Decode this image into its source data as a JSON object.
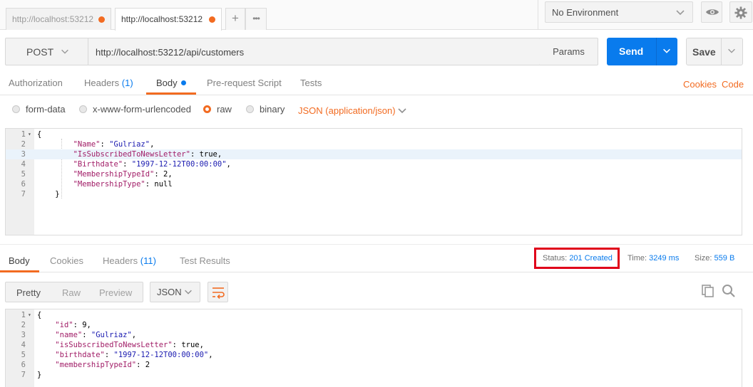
{
  "tabs": [
    {
      "label": "http://localhost:53212",
      "active": false
    },
    {
      "label": "http://localhost:53212",
      "active": true
    }
  ],
  "tab_add_label": "+",
  "tab_more_label": "•••",
  "environment": {
    "selected": "No Environment"
  },
  "request": {
    "method": "POST",
    "url": "http://localhost:53212/api/customers",
    "params_label": "Params",
    "send_label": "Send",
    "save_label": "Save"
  },
  "request_tabs": {
    "authorization": "Authorization",
    "headers": "Headers",
    "headers_count": "(1)",
    "body": "Body",
    "prerequest": "Pre-request Script",
    "tests": "Tests",
    "cookies": "Cookies",
    "code": "Code"
  },
  "body_types": {
    "form_data": "form-data",
    "urlencoded": "x-www-form-urlencoded",
    "raw": "raw",
    "binary": "binary",
    "selected": "raw",
    "content_type": "JSON (application/json)"
  },
  "request_body": {
    "lines": [
      {
        "n": "1",
        "fold": true,
        "tokens": [
          {
            "t": "p",
            "v": "{"
          }
        ]
      },
      {
        "n": "2",
        "tokens": [
          {
            "t": "p",
            "v": "        "
          },
          {
            "t": "k",
            "v": "\"Name\""
          },
          {
            "t": "p",
            "v": ": "
          },
          {
            "t": "s",
            "v": "\"Gulriaz\""
          },
          {
            "t": "p",
            "v": ","
          }
        ]
      },
      {
        "n": "3",
        "hl": true,
        "tokens": [
          {
            "t": "p",
            "v": "        "
          },
          {
            "t": "k",
            "v": "\"IsSubscribedToNewsLetter\""
          },
          {
            "t": "p",
            "v": ": true,"
          }
        ]
      },
      {
        "n": "4",
        "tokens": [
          {
            "t": "p",
            "v": "        "
          },
          {
            "t": "k",
            "v": "\"Birthdate\""
          },
          {
            "t": "p",
            "v": ": "
          },
          {
            "t": "s",
            "v": "\"1997-12-12T00:00:00\""
          },
          {
            "t": "p",
            "v": ","
          }
        ]
      },
      {
        "n": "5",
        "tokens": [
          {
            "t": "p",
            "v": "        "
          },
          {
            "t": "k",
            "v": "\"MembershipTypeId\""
          },
          {
            "t": "p",
            "v": ": 2,"
          }
        ]
      },
      {
        "n": "6",
        "tokens": [
          {
            "t": "p",
            "v": "        "
          },
          {
            "t": "k",
            "v": "\"MembershipType\""
          },
          {
            "t": "p",
            "v": ": null"
          }
        ]
      },
      {
        "n": "7",
        "tokens": [
          {
            "t": "p",
            "v": "    }"
          }
        ]
      }
    ]
  },
  "response_tabs": {
    "body": "Body",
    "cookies": "Cookies",
    "headers": "Headers",
    "headers_count": "(11)",
    "test_results": "Test Results"
  },
  "response_meta": {
    "status_label": "Status:",
    "status_value": "201 Created",
    "time_label": "Time:",
    "time_value": "3249 ms",
    "size_label": "Size:",
    "size_value": "559 B"
  },
  "response_view": {
    "pretty": "Pretty",
    "raw": "Raw",
    "preview": "Preview",
    "format": "JSON"
  },
  "response_body": {
    "lines": [
      {
        "n": "1",
        "fold": true,
        "tokens": [
          {
            "t": "p",
            "v": "{"
          }
        ]
      },
      {
        "n": "2",
        "tokens": [
          {
            "t": "p",
            "v": "    "
          },
          {
            "t": "k",
            "v": "\"id\""
          },
          {
            "t": "p",
            "v": ": 9,"
          }
        ]
      },
      {
        "n": "3",
        "tokens": [
          {
            "t": "p",
            "v": "    "
          },
          {
            "t": "k",
            "v": "\"name\""
          },
          {
            "t": "p",
            "v": ": "
          },
          {
            "t": "s",
            "v": "\"Gulriaz\""
          },
          {
            "t": "p",
            "v": ","
          }
        ]
      },
      {
        "n": "4",
        "tokens": [
          {
            "t": "p",
            "v": "    "
          },
          {
            "t": "k",
            "v": "\"isSubscribedToNewsLetter\""
          },
          {
            "t": "p",
            "v": ": true,"
          }
        ]
      },
      {
        "n": "5",
        "tokens": [
          {
            "t": "p",
            "v": "    "
          },
          {
            "t": "k",
            "v": "\"birthdate\""
          },
          {
            "t": "p",
            "v": ": "
          },
          {
            "t": "s",
            "v": "\"1997-12-12T00:00:00\""
          },
          {
            "t": "p",
            "v": ","
          }
        ]
      },
      {
        "n": "6",
        "tokens": [
          {
            "t": "p",
            "v": "    "
          },
          {
            "t": "k",
            "v": "\"membershipTypeId\""
          },
          {
            "t": "p",
            "v": ": 2"
          }
        ]
      },
      {
        "n": "7",
        "tokens": [
          {
            "t": "p",
            "v": "}"
          }
        ]
      }
    ]
  },
  "colors": {
    "accent_orange": "#f26b21",
    "accent_blue": "#097bed",
    "status_highlight": "#e0001a"
  },
  "icons": [
    "chevron-down-icon",
    "eye-icon",
    "gear-icon",
    "wrap-lines-icon",
    "copy-icon",
    "search-icon"
  ]
}
